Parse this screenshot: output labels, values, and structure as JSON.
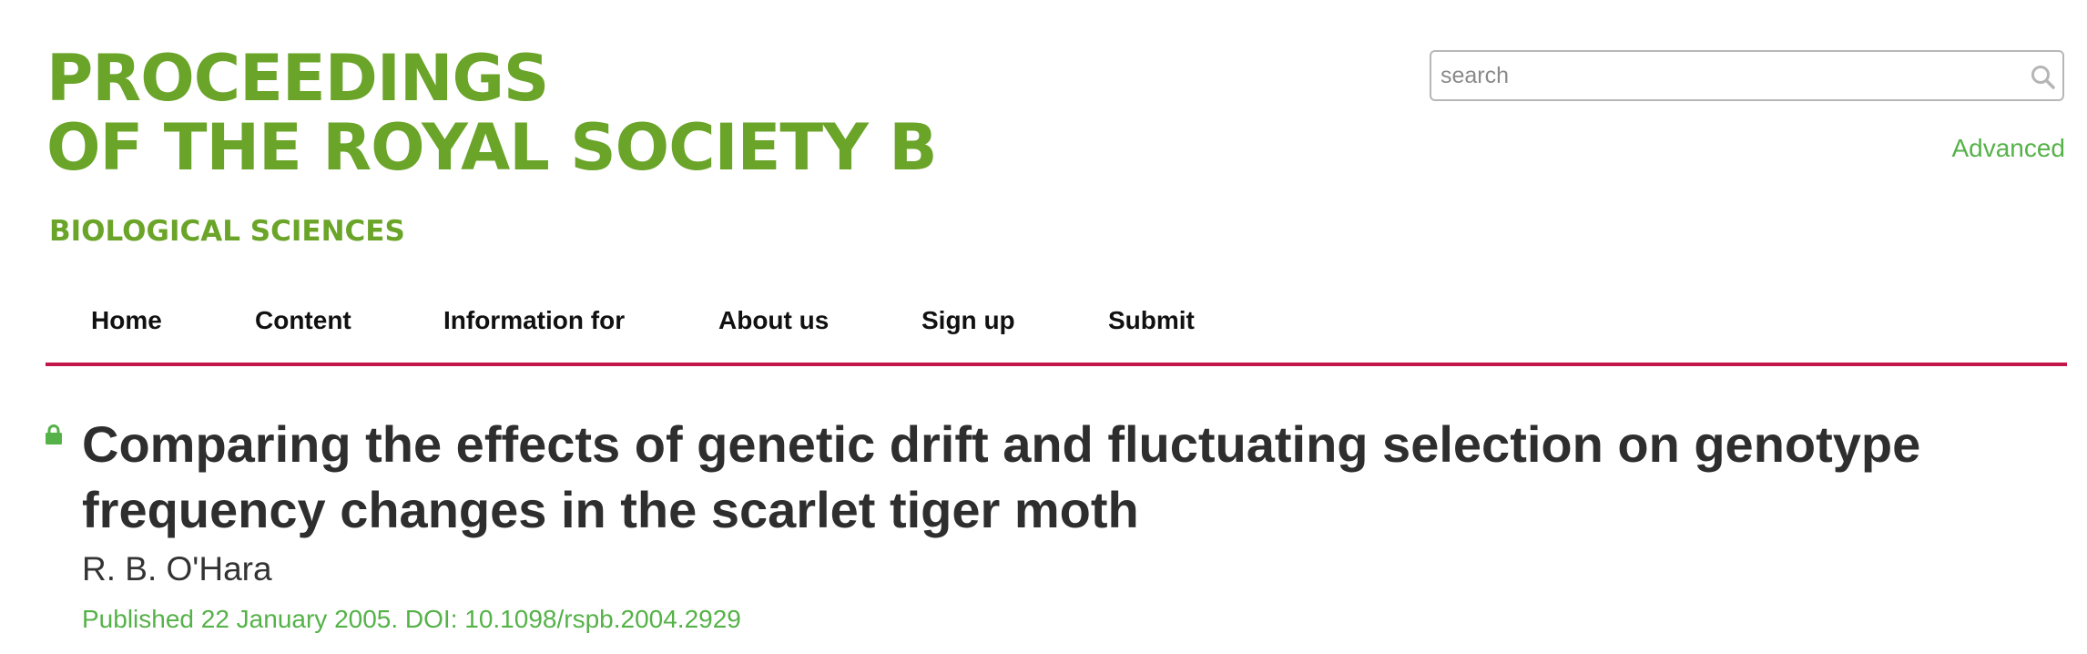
{
  "header": {
    "logo_line1": "PROCEEDINGS",
    "logo_line2": "OF THE ROYAL SOCIETY B",
    "logo_subtitle": "BIOLOGICAL SCIENCES",
    "brand_color": "#6aa428"
  },
  "search": {
    "placeholder": "search",
    "value": "",
    "icon": "search-icon",
    "advanced_label": "Advanced"
  },
  "nav": {
    "items": [
      {
        "label": "Home"
      },
      {
        "label": "Content"
      },
      {
        "label": "Information for"
      },
      {
        "label": "About us"
      },
      {
        "label": "Sign up"
      },
      {
        "label": "Submit"
      }
    ],
    "accent_color": "#c3174a"
  },
  "article": {
    "access_icon": "lock-icon",
    "title": "Comparing the effects of genetic drift and fluctuating selection on genotype frequency changes in the scarlet tiger moth",
    "author": "R. B. O'Hara",
    "published": "Published 22 January 2005. DOI: 10.1098/rspb.2004.2929",
    "link_color": "#55b248"
  }
}
